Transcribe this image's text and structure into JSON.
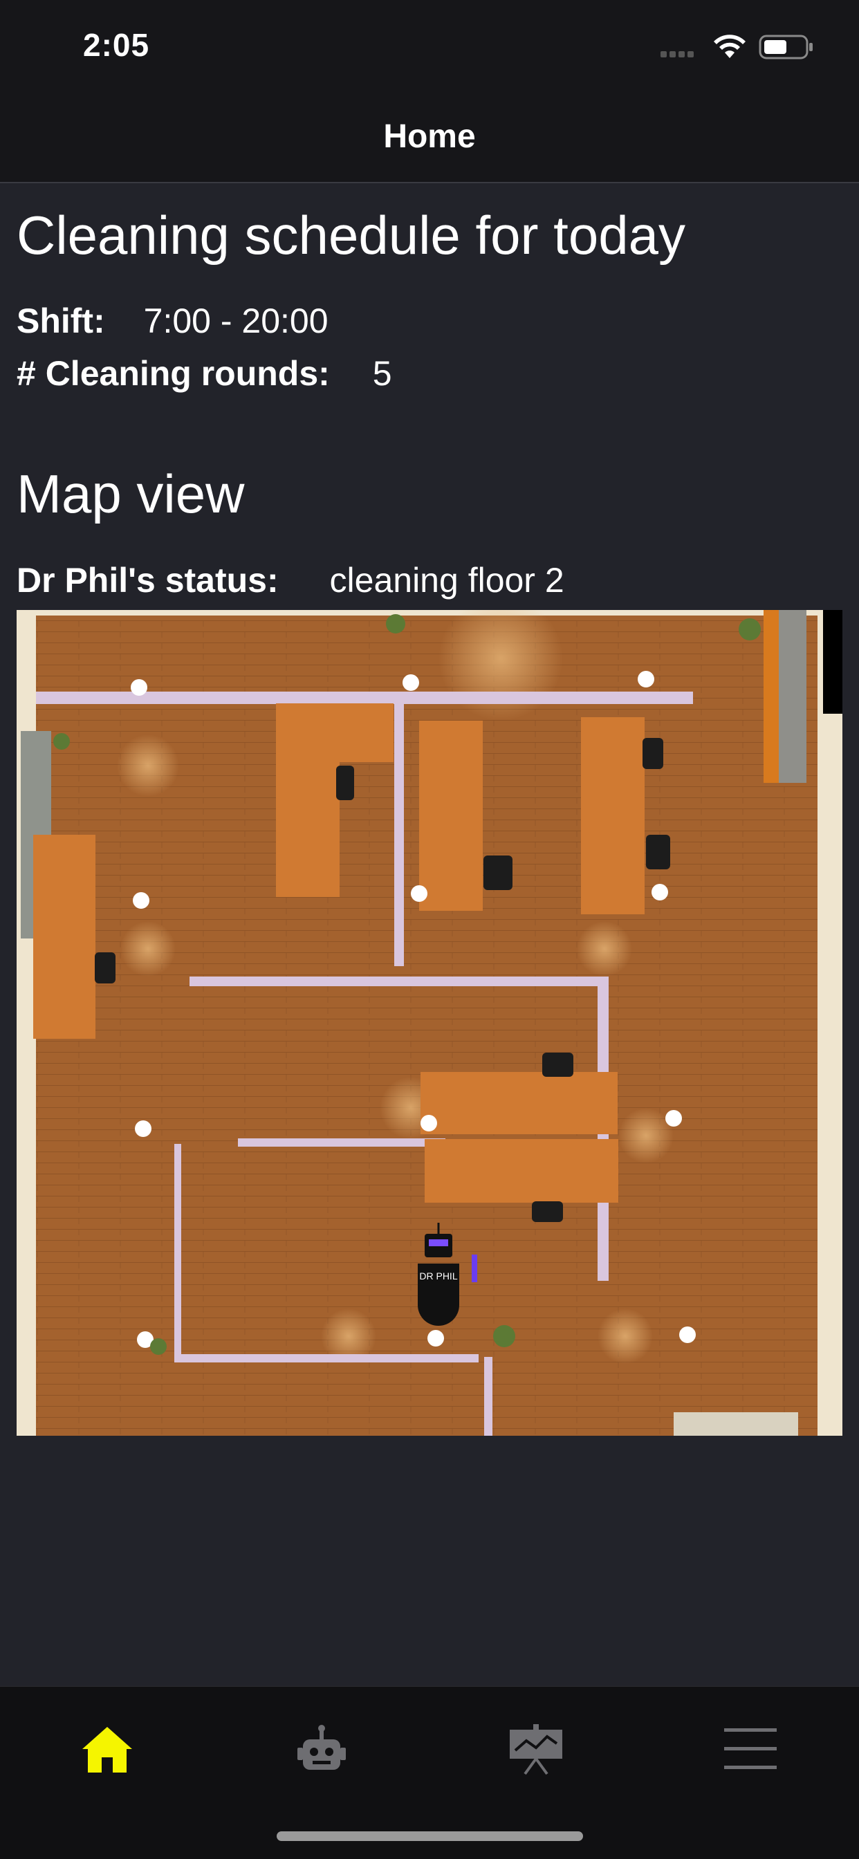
{
  "status_bar": {
    "time": "2:05"
  },
  "nav": {
    "title": "Home"
  },
  "schedule": {
    "heading": "Cleaning schedule for today",
    "shift_label": "Shift:",
    "shift_value": "7:00 - 20:00",
    "rounds_label": "# Cleaning rounds:",
    "rounds_value": "5"
  },
  "map": {
    "heading": "Map view",
    "status_label": "Dr Phil's status:",
    "status_value": "cleaning floor 2",
    "robot_label": "DR PHIL"
  },
  "tabs": [
    {
      "name": "home",
      "icon": "home-icon",
      "active": true
    },
    {
      "name": "robot",
      "icon": "robot-icon",
      "active": false
    },
    {
      "name": "stats",
      "icon": "presentation-chart-icon",
      "active": false
    },
    {
      "name": "menu",
      "icon": "menu-icon",
      "active": false
    }
  ],
  "colors": {
    "active_tab": "#f5f500",
    "inactive_tab": "#6e6e72",
    "background": "#22232a",
    "bar": "#161619"
  }
}
